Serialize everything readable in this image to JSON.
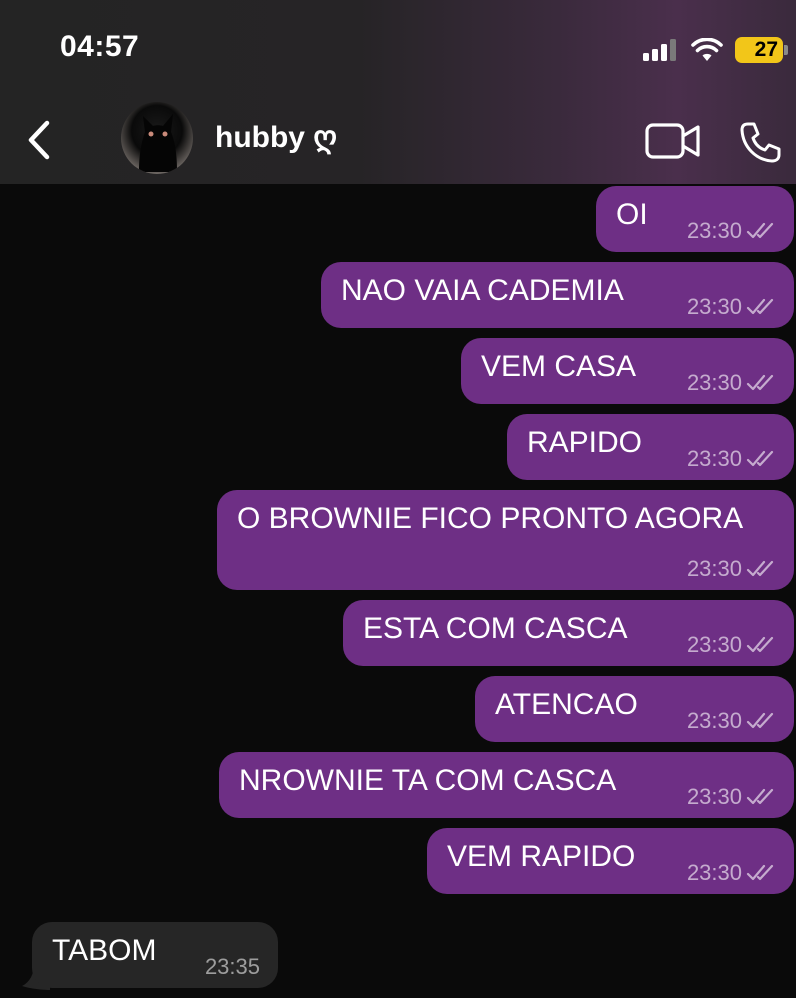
{
  "status_bar": {
    "time": "04:57",
    "battery_level": "27"
  },
  "header": {
    "contact_name": "hubby ღ"
  },
  "messages": [
    {
      "text": "OI",
      "time": "23:30"
    },
    {
      "text": "NAO VAIA CADEMIA",
      "time": "23:30"
    },
    {
      "text": "VEM CASA",
      "time": "23:30"
    },
    {
      "text": "RAPIDO",
      "time": "23:30"
    },
    {
      "text": "O BROWNIE FICO PRONTO AGORA",
      "time": "23:30"
    },
    {
      "text": "ESTA COM CASCA",
      "time": "23:30"
    },
    {
      "text": "ATENCAO",
      "time": "23:30"
    },
    {
      "text": "NROWNIE TA COM CASCA",
      "time": "23:30"
    },
    {
      "text": "VEM RAPIDO",
      "time": "23:30"
    }
  ],
  "received": {
    "text": "TABOM",
    "time": "23:35"
  },
  "colors": {
    "sent_bubble": "#6e2f85",
    "received_bubble": "#262626",
    "background": "#0a0a0a",
    "battery": "#f2c619"
  },
  "icons": [
    "signal-icon",
    "wifi-icon",
    "battery-icon",
    "back-icon",
    "video-call-icon",
    "phone-icon",
    "double-check-icon"
  ]
}
